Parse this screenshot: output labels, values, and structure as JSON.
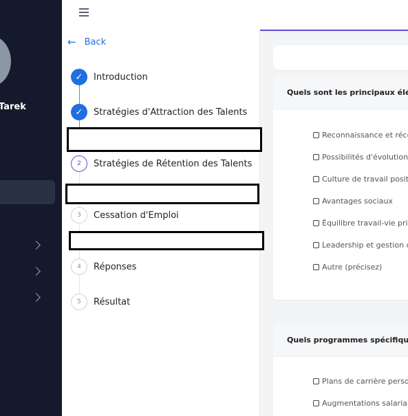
{
  "sidebar": {
    "user_name": "Tarek"
  },
  "steps_panel": {
    "back_label": "Back",
    "steps": [
      {
        "label": "Introduction",
        "marker": "✓",
        "status": "done"
      },
      {
        "label": "Stratégies d'Attraction des Talents",
        "marker": "✓",
        "status": "done"
      },
      {
        "label": "Stratégies de Rétention des Talents",
        "marker": "2",
        "status": "current"
      },
      {
        "label": "Cessation d'Emploi",
        "marker": "3",
        "status": "todo"
      },
      {
        "label": "Réponses",
        "marker": "4",
        "status": "todo"
      },
      {
        "label": "Résultat",
        "marker": "5",
        "status": "todo"
      }
    ]
  },
  "questions": [
    {
      "title": "Quels sont les principaux élém",
      "options": [
        "Reconnaissance et réco",
        "Possibilités d'évolution d",
        "Culture de travail positi",
        "Avantages sociaux",
        "Équilibre travail-vie priv",
        "Leadership et gestion d",
        "Autre (précisez)"
      ]
    },
    {
      "title": "Quels programmes spécifiques",
      "options": [
        "Plans de carrière perso",
        "Augmentations salariale"
      ]
    }
  ],
  "colors": {
    "sidebar_bg": "#141a2b",
    "accent_blue": "#1f6fe0",
    "accent_purple": "#5b4fd6",
    "timeline_teal": "#3aa3a3"
  }
}
